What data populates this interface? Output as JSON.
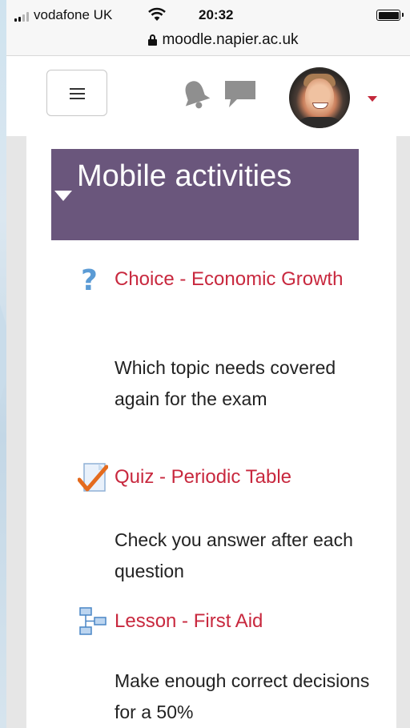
{
  "status_bar": {
    "carrier": "vodafone UK",
    "time": "20:32"
  },
  "browser": {
    "url": "moodle.napier.ac.uk"
  },
  "navbar": {
    "menu_icon": "hamburger-icon",
    "notifications_icon": "bell-icon",
    "messages_icon": "chat-bubble-icon",
    "accent_color": "#c4283b"
  },
  "section": {
    "title": "Mobile activities",
    "header_color": "#6a567c"
  },
  "activities": [
    {
      "icon": "choice-question-icon",
      "link": "Choice - Economic Growth",
      "description": "Which topic needs covered again for the exam"
    },
    {
      "icon": "quiz-checkmark-icon",
      "link": "Quiz - Periodic Table",
      "description": "Check you answer after each question"
    },
    {
      "icon": "lesson-flowchart-icon",
      "link": "Lesson - First Aid",
      "description": "Make enough correct decisions for a 50%"
    }
  ],
  "link_color": "#c8283e"
}
